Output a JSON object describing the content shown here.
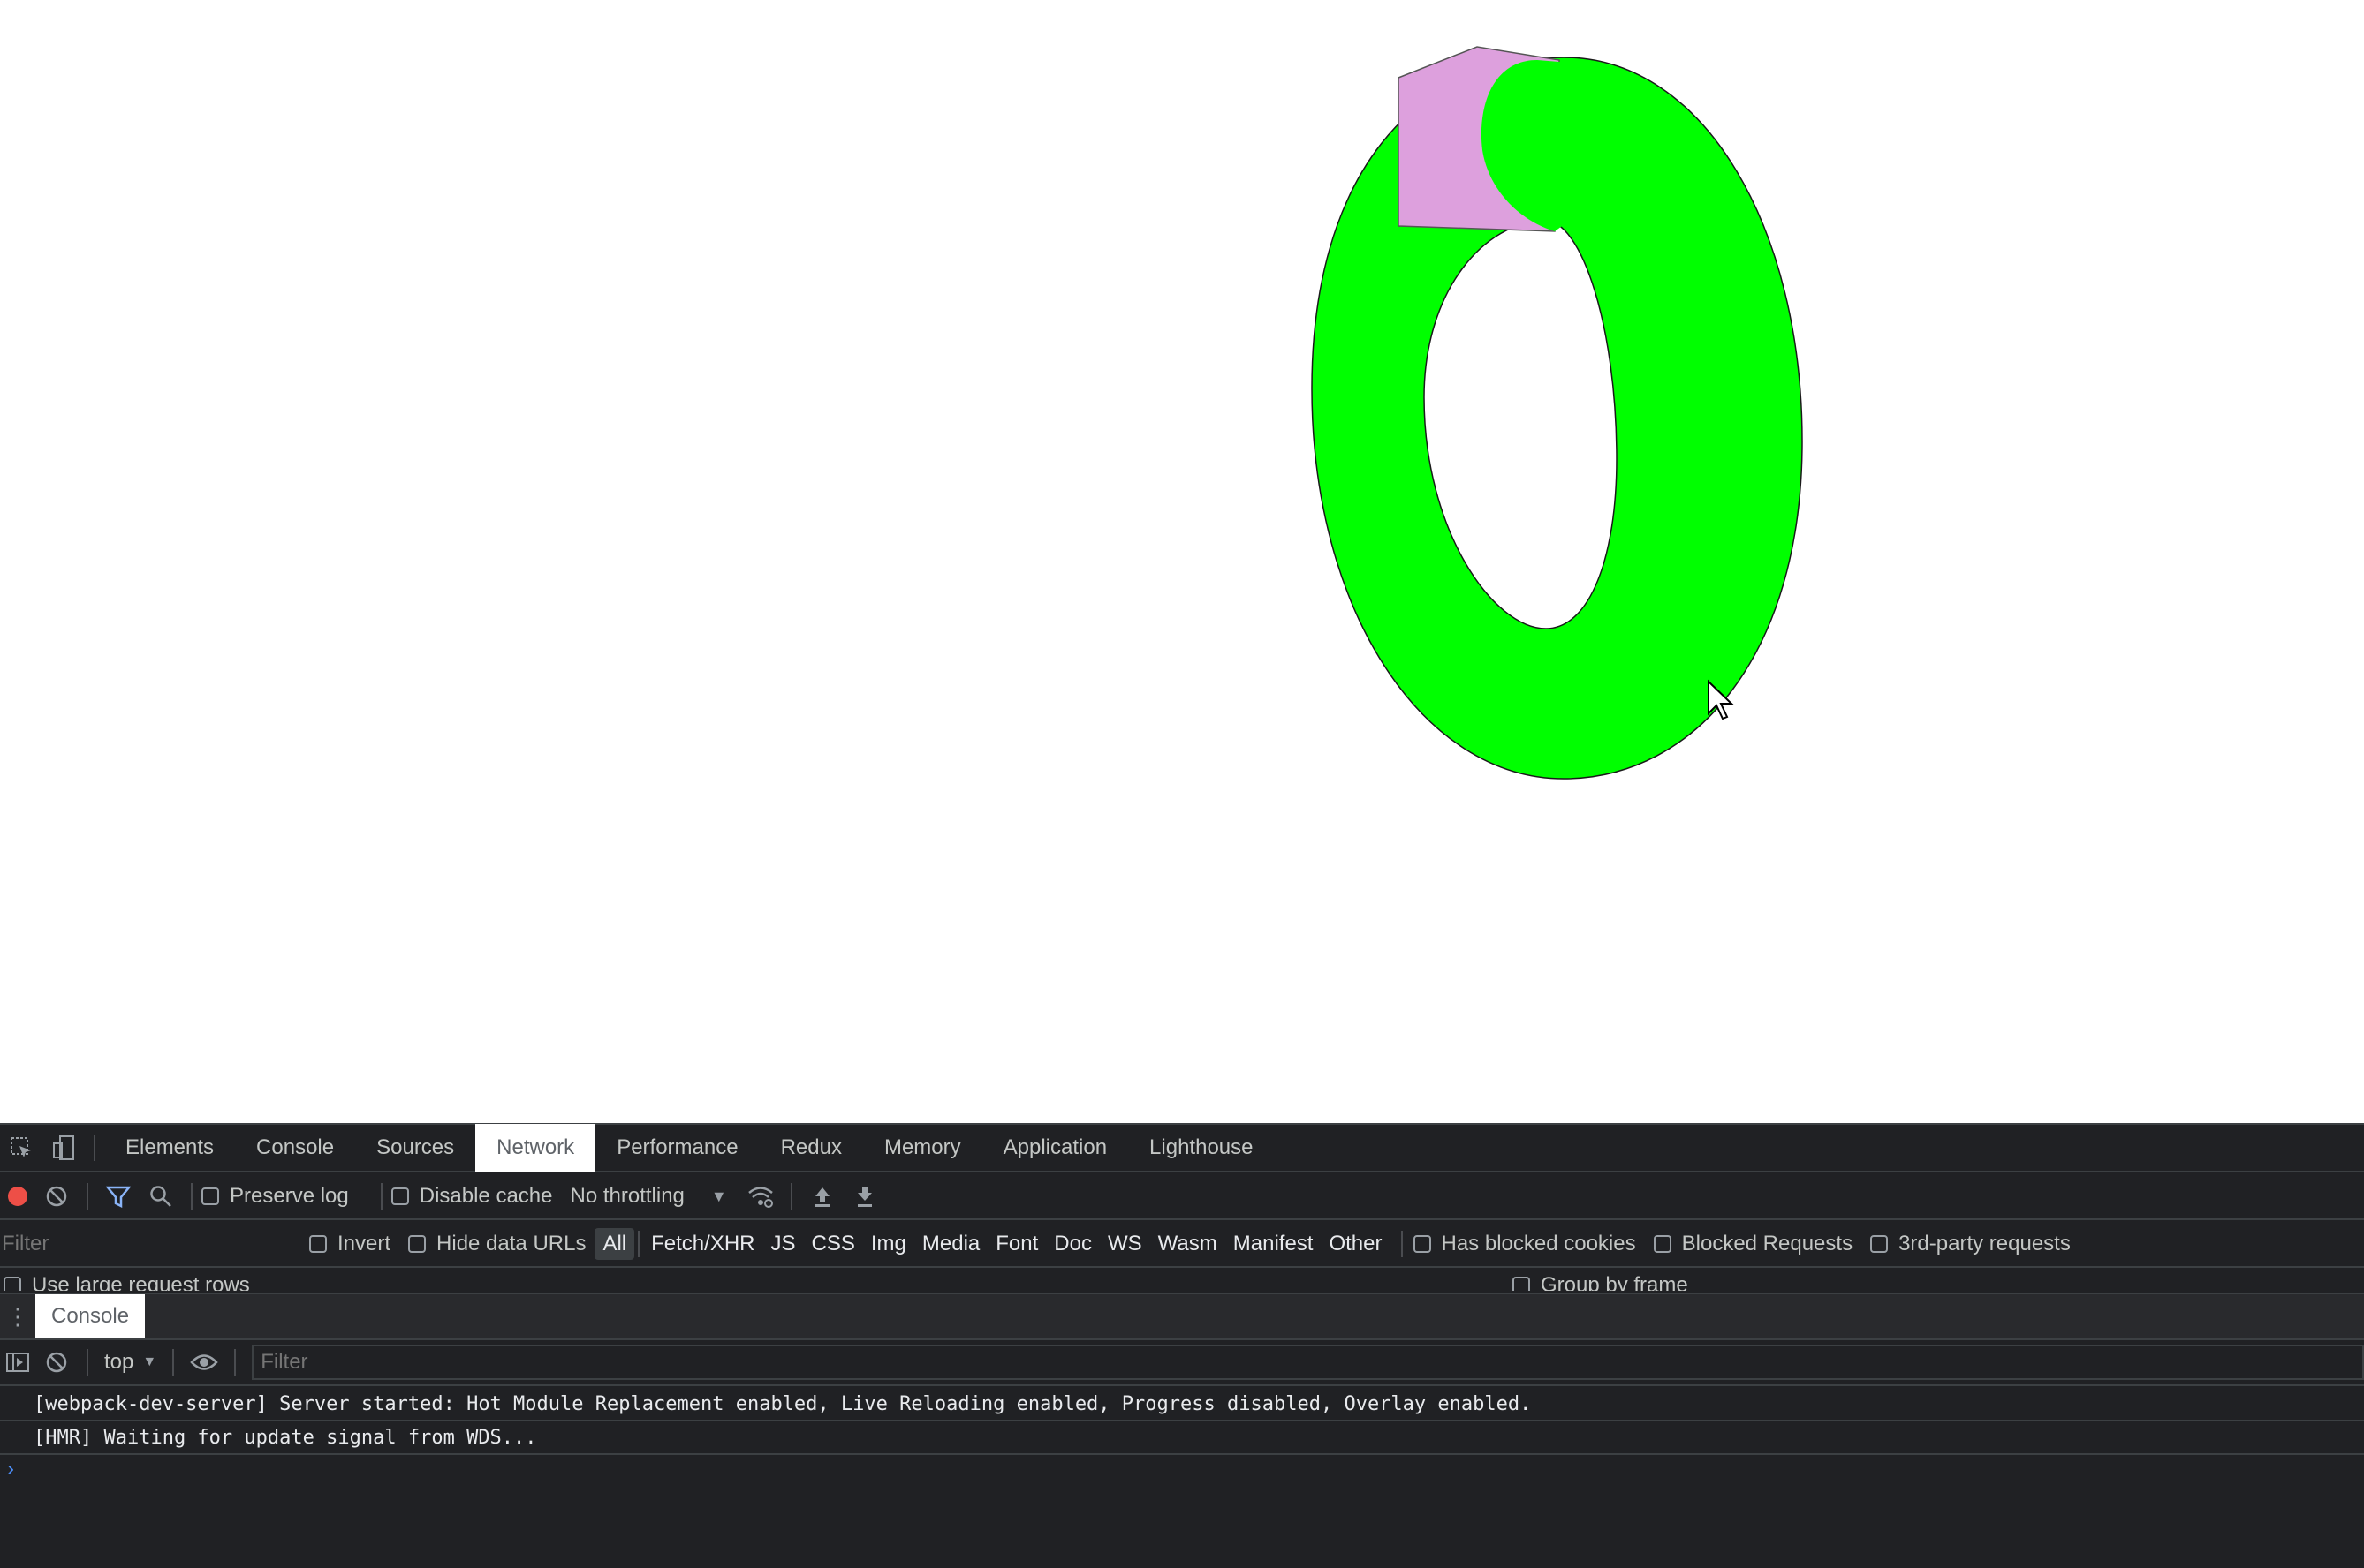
{
  "devtools": {
    "tabs": [
      "Elements",
      "Console",
      "Sources",
      "Network",
      "Performance",
      "Redux",
      "Memory",
      "Application",
      "Lighthouse"
    ],
    "active_tab": "Network",
    "network_toolbar": {
      "preserve_log": "Preserve log",
      "disable_cache": "Disable cache",
      "throttling": "No throttling"
    },
    "filter_row": {
      "filter_placeholder": "Filter",
      "invert": "Invert",
      "hide_data_urls": "Hide data URLs",
      "types": [
        "All",
        "Fetch/XHR",
        "JS",
        "CSS",
        "Img",
        "Media",
        "Font",
        "Doc",
        "WS",
        "Wasm",
        "Manifest",
        "Other"
      ],
      "active_type": "All",
      "has_blocked_cookies": "Has blocked cookies",
      "blocked_requests": "Blocked Requests",
      "third_party": "3rd-party requests"
    },
    "large_rows": "Use large request rows",
    "group_by_frame": "Group by frame",
    "drawer": {
      "tab": "Console",
      "context": "top",
      "filter_placeholder": "Filter",
      "messages": [
        "[webpack-dev-server] Server started: Hot Module Replacement enabled, Live Reloading enabled, Progress disabled, Overlay enabled.",
        "[HMR] Waiting for update signal from WDS..."
      ],
      "prompt": "›"
    }
  },
  "colors": {
    "torus": "#00ff00",
    "pentagon": "#dda0dd",
    "record": "#ee4f47",
    "devtools_bg": "#202124"
  },
  "icons": [
    "inspect-icon",
    "device-toolbar-icon",
    "record-icon",
    "clear-icon",
    "filter-icon",
    "search-icon",
    "network-conditions-icon",
    "import-har-icon",
    "export-har-icon",
    "drawer-menu-icon",
    "sidebar-toggle-icon",
    "live-expression-eye-icon",
    "dropdown-arrow-icon"
  ]
}
